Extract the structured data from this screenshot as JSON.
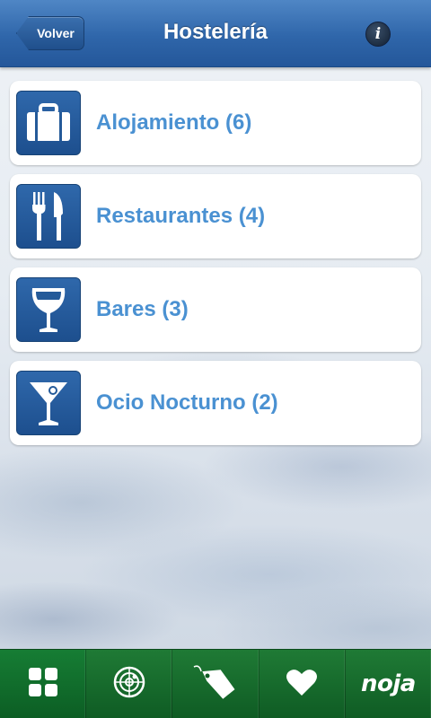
{
  "header": {
    "back_label": "Volver",
    "title": "Hostelería",
    "info_glyph": "i"
  },
  "categories": [
    {
      "label": "Alojamiento (6)",
      "icon": "suitcase-icon"
    },
    {
      "label": "Restaurantes (4)",
      "icon": "fork-knife-icon"
    },
    {
      "label": "Bares (3)",
      "icon": "wine-glass-icon"
    },
    {
      "label": "Ocio Nocturno (2)",
      "icon": "cocktail-icon"
    }
  ],
  "tabbar": {
    "tabs": [
      {
        "icon": "grid-icon"
      },
      {
        "icon": "radar-icon"
      },
      {
        "icon": "tag-icon"
      },
      {
        "icon": "heart-icon"
      }
    ],
    "logo_text": "noja"
  },
  "colors": {
    "header": "#2f66aa",
    "accent_text": "#4a91d2",
    "tabbar": "#1f7a35"
  }
}
